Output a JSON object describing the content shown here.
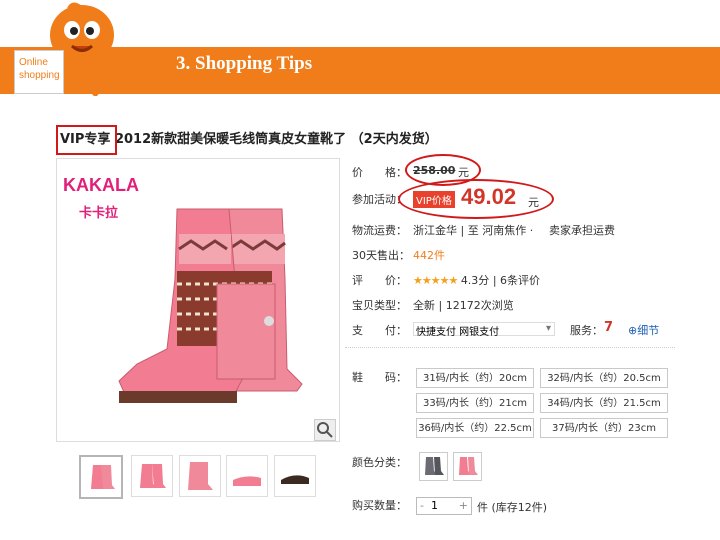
{
  "header": {
    "title": "3. Shopping Tips",
    "badge_line1": "Online",
    "badge_line2": "shopping"
  },
  "product": {
    "title": "VIP专享 2012新款甜美保暖毛线筒真皮女童靴了 （2天内发货）",
    "brand_en": "KAKALA",
    "brand_cn": "卡卡拉"
  },
  "details": {
    "price_label": "价　　格：",
    "original_price": "258.00",
    "yuan": "元",
    "promo_label": "参加活动：",
    "vip_badge": "VIP价格",
    "vip_price": "49.02",
    "shipping_label": "物流运费：",
    "shipping_value": "浙江金华 | 至 河南焦作 ·",
    "shipping_note": "卖家承担运费",
    "sales_prefix": "30",
    "sales_label": "天售出：",
    "sales_value": "442件",
    "rating_label": "评　　价：",
    "stars": "★★★★★",
    "rating_score": "4.3分",
    "rating_count": "| 6条评价",
    "type_label": "宝贝类型：",
    "type_value": "全新 | 12172次浏览",
    "pay_label": "支　　付：",
    "pay_value": "快捷支付 网银支付",
    "service_label": "服务：",
    "service_7": "7",
    "service_detail": "细节",
    "size_label": "鞋　　码：",
    "sizes": [
      "31码/内长（约）20cm",
      "32码/内长（约）20.5cm",
      "33码/内长（约）21cm",
      "34码/内长（约）21.5cm",
      "36码/内长（约）22.5cm",
      "37码/内长（约）23cm"
    ],
    "color_label": "颜色分类：",
    "qty_label": "购买数量：",
    "qty_value": "1",
    "stock_text": "件 (库存12件)"
  }
}
